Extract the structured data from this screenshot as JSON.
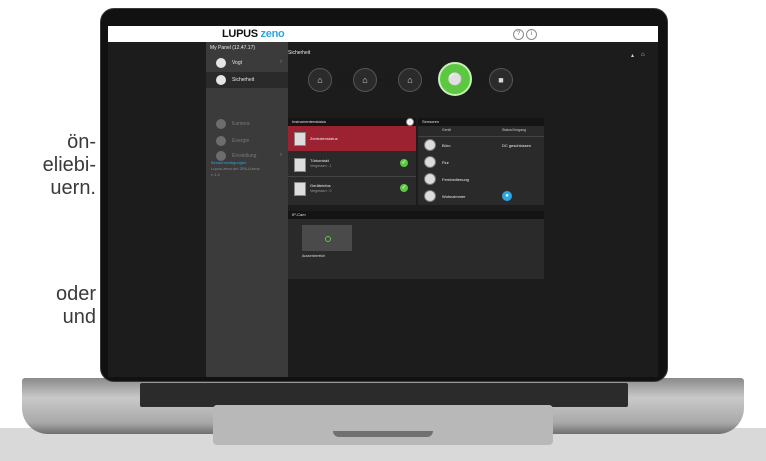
{
  "side_text": {
    "block1": [
      "ön-",
      "eliebi-",
      "uern."
    ],
    "block2": [
      "oder",
      "und"
    ]
  },
  "app": {
    "brand_main": "LUPUS",
    "brand_accent": "zeno",
    "help_icon": "?",
    "info_icon": "i"
  },
  "sidebar": {
    "panel_label": "My Panel (12.47.17)",
    "user_name": "Vogt",
    "items": [
      {
        "label": "Sicherheit",
        "icon": "shield-icon",
        "selected": true,
        "enabled": true
      },
      {
        "label": "Kamera",
        "icon": "camera-icon",
        "selected": false,
        "enabled": false
      },
      {
        "label": "Energie",
        "icon": "energy-icon",
        "selected": false,
        "enabled": false
      },
      {
        "label": "Einstellung",
        "icon": "gear-icon",
        "selected": false,
        "enabled": false
      }
    ],
    "info_title": "Benachrichtigungen",
    "info_line1": "Lupus-zeno.de/ 2FA-Lizenz",
    "info_line2": "v 1.4"
  },
  "main": {
    "title": "Sicherheit",
    "modes": [
      {
        "icon": "home-icon",
        "active": false
      },
      {
        "icon": "home-icon",
        "active": false
      },
      {
        "icon": "home-icon",
        "active": false
      },
      {
        "icon": "unlock-icon",
        "active": true
      },
      {
        "icon": "lock-icon",
        "active": false
      }
    ]
  },
  "alarm_card": {
    "header": "Instrumentenstatus",
    "alarm_label": "Zentralenstatus",
    "rows": [
      {
        "label": "Türkontakt",
        "sub": "Vergessen : 1"
      },
      {
        "label": "Geräteinfos",
        "sub": "Vergessen : 0"
      }
    ]
  },
  "sensor_card": {
    "header": "Sensoren",
    "col_device": "Gerät",
    "col_status": "Status/Vorgang",
    "rows": [
      {
        "name": "Büro",
        "status": "DC geschlossen"
      },
      {
        "name": "Flur",
        "status": ""
      },
      {
        "name": "Fernbedienung",
        "status": ""
      },
      {
        "name": "Wohnzimmer",
        "status": ""
      }
    ]
  },
  "ipcam_card": {
    "header": "IP-Cam",
    "camera_label": "Aussenbereich"
  },
  "colors": {
    "accent": "#2ca5e0",
    "active_mode": "#5cc841",
    "alarm": "#9c2231"
  }
}
